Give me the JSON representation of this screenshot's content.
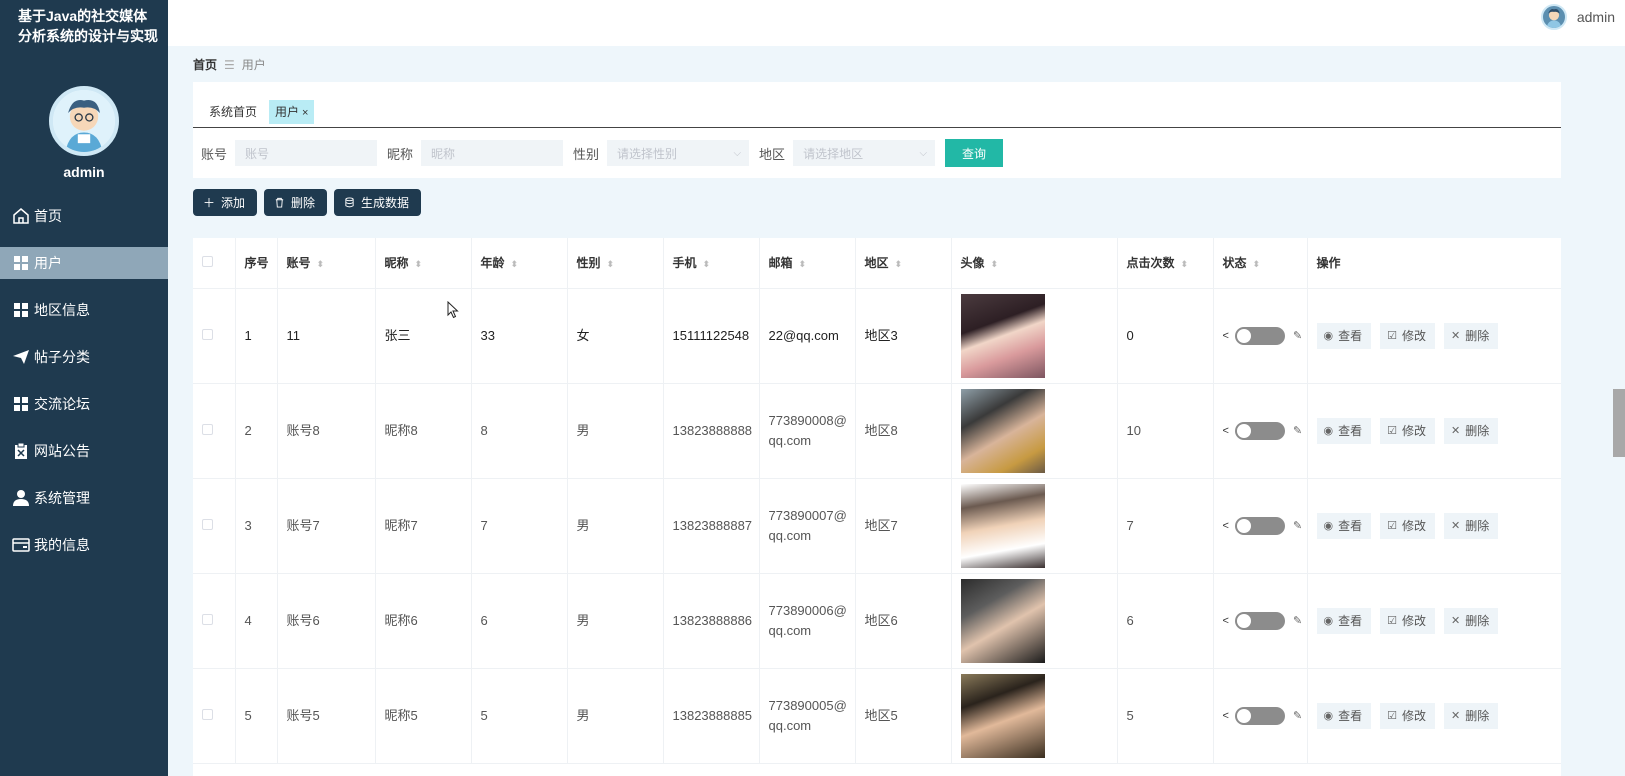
{
  "sidebar": {
    "app_title": "基于Java的社交媒体分析系统的设计与实现",
    "user_name": "admin",
    "menu": [
      {
        "label": "首页",
        "icon": "home-icon"
      },
      {
        "label": "用户",
        "icon": "grid-icon",
        "active": true
      },
      {
        "label": "地区信息",
        "icon": "grid-icon"
      },
      {
        "label": "帖子分类",
        "icon": "send-icon"
      },
      {
        "label": "交流论坛",
        "icon": "grid-icon"
      },
      {
        "label": "网站公告",
        "icon": "clipboard-icon"
      },
      {
        "label": "系统管理",
        "icon": "user-icon"
      },
      {
        "label": "我的信息",
        "icon": "card-icon"
      }
    ]
  },
  "topbar": {
    "user_name": "admin"
  },
  "breadcrumb": {
    "home": "首页",
    "separator": "☰",
    "current": "用户"
  },
  "tabs": [
    {
      "label": "系统首页"
    },
    {
      "label": "用户",
      "closable": "×"
    }
  ],
  "filters": {
    "account_label": "账号",
    "account_placeholder": "账号",
    "nickname_label": "昵称",
    "nickname_placeholder": "昵称",
    "gender_label": "性别",
    "gender_placeholder": "请选择性别",
    "region_label": "地区",
    "region_placeholder": "请选择地区",
    "query_button": "查询"
  },
  "actions": {
    "add": "添加",
    "delete": "删除",
    "generate": "生成数据"
  },
  "table": {
    "columns": [
      "序号",
      "账号",
      "昵称",
      "年龄",
      "性别",
      "手机",
      "邮箱",
      "地区",
      "头像",
      "点击次数",
      "状态",
      "操作"
    ],
    "rows": [
      {
        "index": "1",
        "account": "11",
        "nickname": "张三",
        "age": "33",
        "gender": "女",
        "phone": "15111122548",
        "email": "22@qq.com",
        "region": "地区3",
        "clicks": "0"
      },
      {
        "index": "2",
        "account": "账号8",
        "nickname": "昵称8",
        "age": "8",
        "gender": "男",
        "phone": "13823888888",
        "email": "773890008@qq.com",
        "region": "地区8",
        "clicks": "10"
      },
      {
        "index": "3",
        "account": "账号7",
        "nickname": "昵称7",
        "age": "7",
        "gender": "男",
        "phone": "13823888887",
        "email": "773890007@qq.com",
        "region": "地区7",
        "clicks": "7"
      },
      {
        "index": "4",
        "account": "账号6",
        "nickname": "昵称6",
        "age": "6",
        "gender": "男",
        "phone": "13823888886",
        "email": "773890006@qq.com",
        "region": "地区6",
        "clicks": "6"
      },
      {
        "index": "5",
        "account": "账号5",
        "nickname": "昵称5",
        "age": "5",
        "gender": "男",
        "phone": "13823888885",
        "email": "773890005@qq.com",
        "region": "地区5",
        "clicks": "5"
      }
    ],
    "row_actions": {
      "view": "查看",
      "edit": "修改",
      "delete": "删除"
    }
  },
  "colors": {
    "sidebar_bg": "#1f3a4f",
    "accent": "#22b8a6",
    "active_menu": "#8fa7b8",
    "tab_active": "#b9ecf5"
  }
}
